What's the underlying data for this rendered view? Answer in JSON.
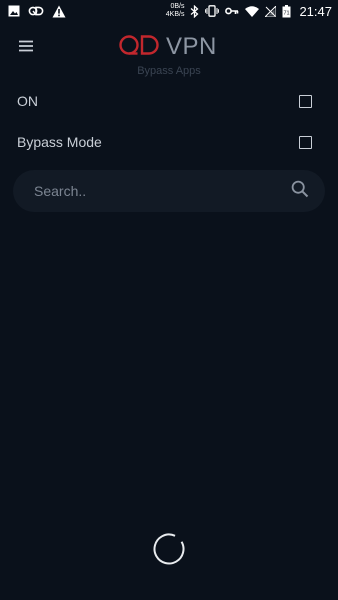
{
  "status_bar": {
    "net_up": "0B/s",
    "net_down": "4KB/s",
    "battery_level": "71",
    "time": "21:47",
    "icons": [
      "image-icon",
      "qd-notification-icon",
      "warning-icon",
      "bluetooth-icon",
      "vibrate-icon",
      "key-icon",
      "wifi-icon",
      "signal-icon",
      "battery-icon"
    ]
  },
  "header": {
    "logo_text": "VPN",
    "subtitle": "Bypass Apps"
  },
  "settings": {
    "on_label": "ON",
    "on_checked": false,
    "bypass_label": "Bypass Mode",
    "bypass_checked": false
  },
  "search": {
    "placeholder": "Search.."
  },
  "colors": {
    "background": "#0a111b",
    "search_bg": "#121a25",
    "logo_accent": "#c2272d",
    "logo_text": "#8d96a3",
    "text": "#c9cfd7"
  }
}
